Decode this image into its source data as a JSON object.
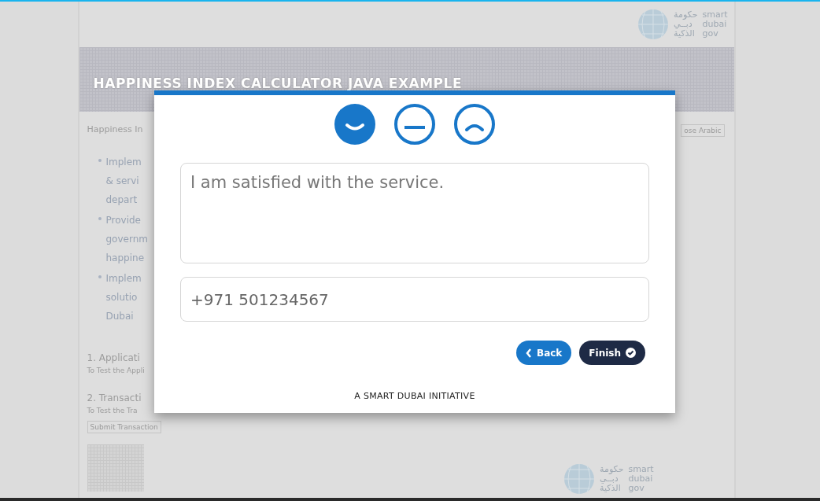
{
  "page": {
    "title": "HAPPINESS INDEX CALCULATOR JAVA EXAMPLE",
    "intro": "Happiness In",
    "language_button": "ose Arabic",
    "bullets": [
      {
        "lines": [
          "Implem",
          "& servi",
          "depart"
        ]
      },
      {
        "lines": [
          "Provide",
          "governm",
          "happine"
        ]
      },
      {
        "lines": [
          "Implem",
          "solutio",
          "Dubai"
        ]
      }
    ],
    "sections": [
      {
        "heading": "1. Applicati",
        "text": "To Test the Appli"
      },
      {
        "heading": "2. Transacti",
        "text": "To Test the Tra",
        "button": "Submit Transaction"
      }
    ],
    "header_logo": {
      "arabic": [
        "حكومة",
        "دبــي",
        "الذكية"
      ],
      "english": [
        "smart",
        "dubai",
        "gov"
      ]
    },
    "footer_logo": {
      "arabic": [
        "حكومة",
        "دبــي",
        "الذكية"
      ],
      "english": [
        "smart",
        "dubai",
        "gov"
      ]
    }
  },
  "dialog": {
    "faces": [
      {
        "kind": "happy",
        "selected": true
      },
      {
        "kind": "neutral",
        "selected": false
      },
      {
        "kind": "sad",
        "selected": false
      }
    ],
    "comment": "I am satisfied with the service.",
    "phone": "+971 501234567",
    "buttons": [
      {
        "kind": "back",
        "label": "Back"
      },
      {
        "kind": "finish",
        "label": "Finish"
      }
    ],
    "footer": "A SMART DUBAI INITIATIVE"
  }
}
